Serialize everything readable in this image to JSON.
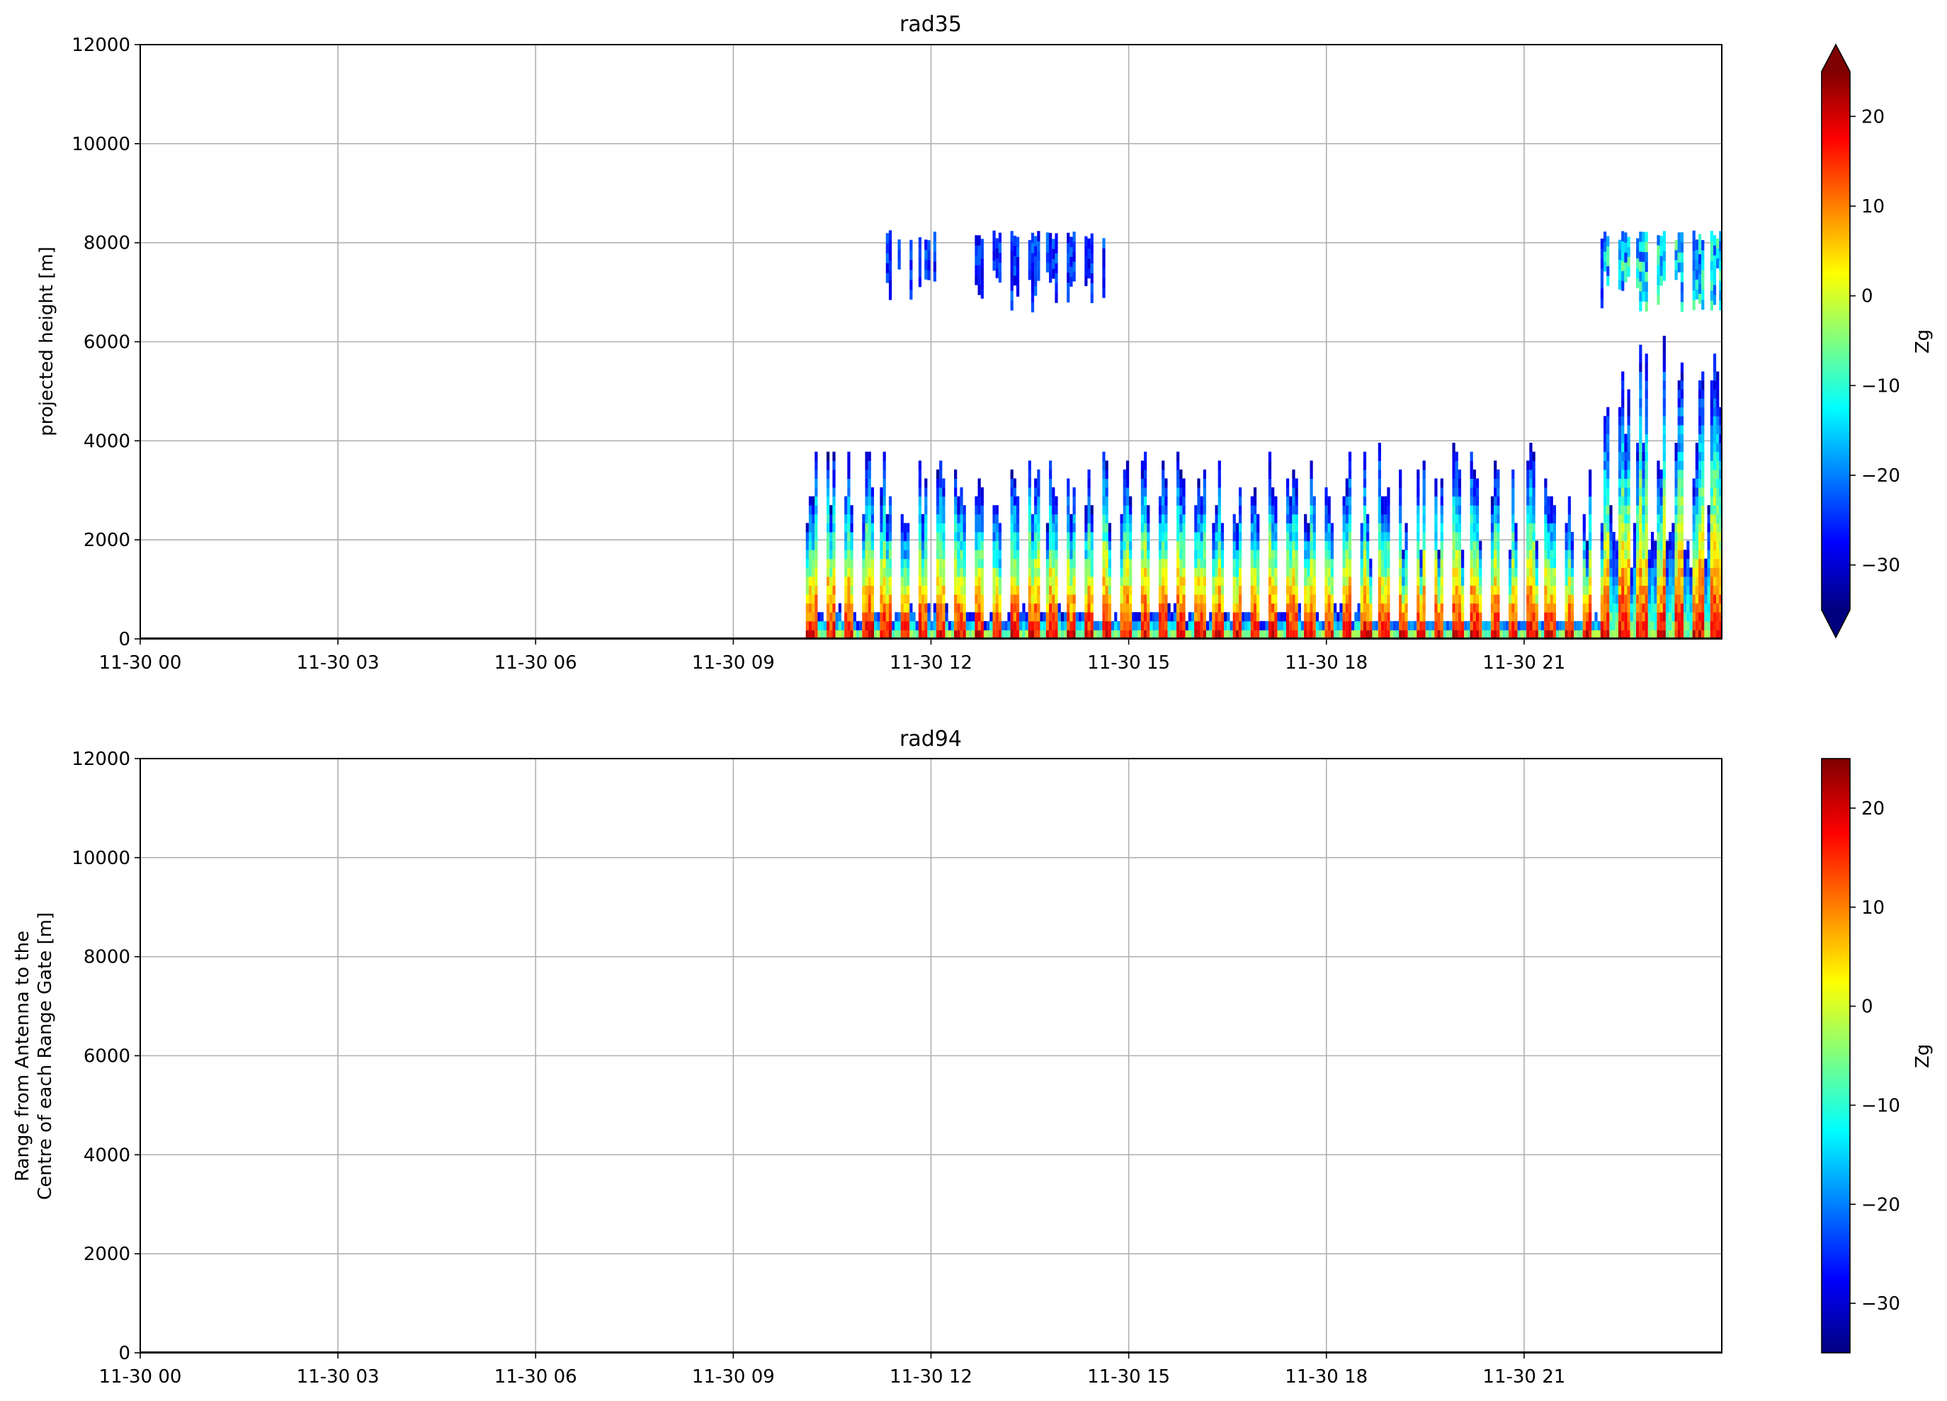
{
  "chart_data": [
    {
      "type": "heatmap",
      "title": "rad35",
      "xlabel": "",
      "ylabel": "projected height [m]",
      "x_range": [
        "11-30 00:00",
        "11-30 24:00"
      ],
      "x_tick_labels": [
        "11-30 00",
        "11-30 03",
        "11-30 06",
        "11-30 09",
        "11-30 12",
        "11-30 15",
        "11-30 18",
        "11-30 21"
      ],
      "x_ticks_hours": [
        0,
        3,
        6,
        9,
        12,
        15,
        18,
        21
      ],
      "ylim": [
        0,
        12000
      ],
      "y_ticks": [
        "0",
        "2000",
        "4000",
        "6000",
        "8000",
        "10000",
        "12000"
      ],
      "grid": true,
      "colorbar": {
        "label": "Zg",
        "colormap": "jet",
        "range": [
          -35,
          25
        ],
        "ticks": [
          "20",
          "10",
          "0",
          "−10",
          "−20",
          "−30"
        ],
        "tick_values": [
          20,
          10,
          0,
          -10,
          -20,
          -30
        ],
        "extend": "both"
      },
      "data_start_hour": 10.1,
      "data_end_hour": 24,
      "data_top_m": 8050,
      "note_shapes": "vertical profiles (time-height reflectivity)"
    },
    {
      "type": "heatmap",
      "title": "rad94",
      "xlabel": "",
      "ylabel": "Range from Antenna to the\nCentre of each Range Gate [m]",
      "ylabel_lines": [
        "Range from Antenna to the",
        "Centre of each Range Gate [m]"
      ],
      "x_range": [
        "11-30 00:00",
        "11-30 24:00"
      ],
      "x_tick_labels": [
        "11-30 00",
        "11-30 03",
        "11-30 06",
        "11-30 09",
        "11-30 12",
        "11-30 15",
        "11-30 18",
        "11-30 21"
      ],
      "x_ticks_hours": [
        0,
        3,
        6,
        9,
        12,
        15,
        18,
        21
      ],
      "ylim": [
        0,
        12000
      ],
      "y_ticks": [
        "0",
        "2000",
        "4000",
        "6000",
        "8000",
        "10000",
        "12000"
      ],
      "grid": true,
      "colorbar": {
        "label": "Zg",
        "colormap": "jet",
        "range": [
          -35,
          25
        ],
        "ticks": [
          "20",
          "10",
          "0",
          "−10",
          "−20",
          "−30"
        ],
        "tick_values": [
          20,
          10,
          0,
          -10,
          -20,
          -30
        ],
        "extend": "neither"
      },
      "data": []
    }
  ]
}
